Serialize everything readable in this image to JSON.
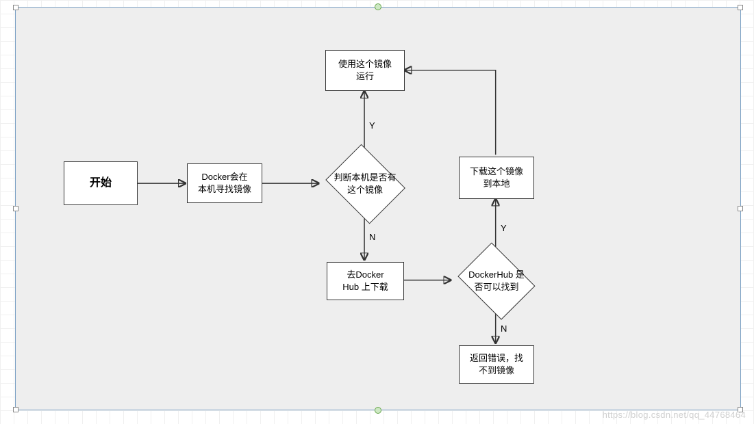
{
  "nodes": {
    "start": {
      "label": "开始"
    },
    "search_local": {
      "label": "Docker会在\n本机寻找镜像"
    },
    "decide_local": {
      "label": "判断本机是否有\n这个镜像"
    },
    "run_image": {
      "label": "使用这个镜像\n运行"
    },
    "download_hub": {
      "label": "去Docker\nHub 上下载"
    },
    "decide_hub": {
      "label": "DockerHub 是\n否可以找到"
    },
    "download_local": {
      "label": "下载这个镜像\n到本地"
    },
    "error": {
      "label": "返回错误，找\n不到镜像"
    }
  },
  "edge_labels": {
    "yes1": "Y",
    "no1": "N",
    "yes2": "Y",
    "no2": "N"
  },
  "watermark": "https://blog.csdn.net/qq_44768464"
}
